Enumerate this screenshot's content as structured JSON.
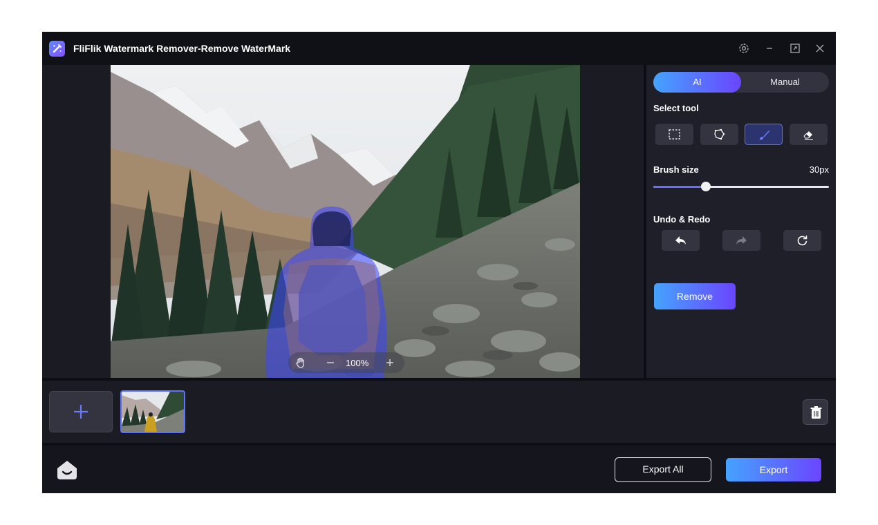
{
  "window": {
    "title": "FliFlik Watermark Remover-Remove WaterMark"
  },
  "canvas": {
    "zoom_level": "100%"
  },
  "panel": {
    "mode_ai": "AI",
    "mode_manual": "Manual",
    "active_mode": "AI",
    "select_tool_label": "Select tool",
    "tools": [
      "rectangle-select",
      "lasso-select",
      "brush",
      "eraser"
    ],
    "active_tool": "brush",
    "brush_size_label": "Brush size",
    "brush_size_value": "30px",
    "brush_slider_fraction": 0.3,
    "undo_redo_label": "Undo & Redo",
    "remove_label": "Remove"
  },
  "footer": {
    "export_all_label": "Export All",
    "export_label": "Export"
  },
  "colors": {
    "accent_start": "#45a3ff",
    "accent_end": "#6b45ff",
    "mask": "#3c46ff"
  }
}
